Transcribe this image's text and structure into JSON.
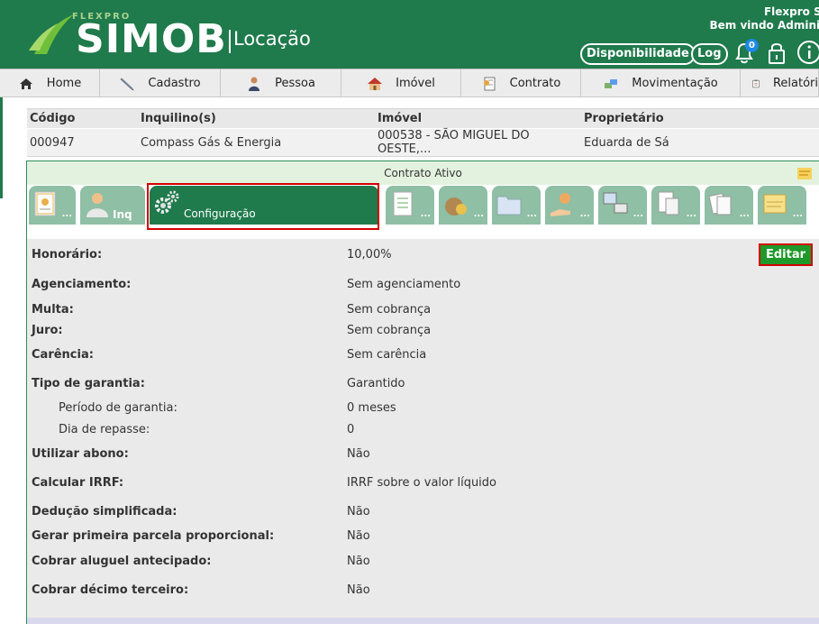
{
  "header": {
    "brand_flexpro": "FLEXPRO",
    "brand_simob": "SIMOB",
    "brand_module": "Locação",
    "company": "Flexpro Sis",
    "welcome": "Bem vindo Administ",
    "availability_label": "Disponibilidade",
    "log_label": "Log",
    "notification_count": "0"
  },
  "nav": {
    "items": [
      {
        "label": "Home",
        "icon": "home-icon"
      },
      {
        "label": "Cadastro",
        "icon": "pen-icon"
      },
      {
        "label": "Pessoa",
        "icon": "person-icon"
      },
      {
        "label": "Imóvel",
        "icon": "house-icon"
      },
      {
        "label": "Contrato",
        "icon": "contract-icon"
      },
      {
        "label": "Movimentação",
        "icon": "transfer-icon"
      },
      {
        "label": "Relatóri",
        "icon": "report-icon"
      }
    ]
  },
  "summary": {
    "headers": [
      "Código",
      "Inquilino(s)",
      "Imóvel",
      "Proprietário"
    ],
    "row": [
      "000947",
      "Compass Gás & Energia",
      "000538 - SÃO MIGUEL DO OESTE,...",
      "Eduarda de Sá"
    ]
  },
  "panel": {
    "title": "Contrato Ativo",
    "tabs": [
      {
        "label": "...",
        "icon": "certificate-icon"
      },
      {
        "label": "Inq",
        "icon": "tenant-icon"
      },
      {
        "label": "Configuração",
        "icon": "gears-icon"
      },
      {
        "label": "...",
        "icon": "checklist-icon"
      },
      {
        "label": "...",
        "icon": "money-bag-icon"
      },
      {
        "label": "...",
        "icon": "folder-icon"
      },
      {
        "label": "...",
        "icon": "coins-hand-icon"
      },
      {
        "label": "...",
        "icon": "transfer-computer-icon"
      },
      {
        "label": "...",
        "icon": "invoice-icon"
      },
      {
        "label": "...",
        "icon": "documents-icon"
      },
      {
        "label": "...",
        "icon": "note-icon"
      }
    ],
    "edit_label": "Editar"
  },
  "config": {
    "honorario": {
      "label": "Honorário:",
      "value": "10,00%"
    },
    "agenciamento": {
      "label": "Agenciamento:",
      "value": "Sem agenciamento"
    },
    "multa": {
      "label": "Multa:",
      "value": "Sem cobrança"
    },
    "juro": {
      "label": "Juro:",
      "value": "Sem cobrança"
    },
    "carencia": {
      "label": "Carência:",
      "value": "Sem carência"
    },
    "tipo_garantia": {
      "label": "Tipo de garantia:",
      "value": "Garantido"
    },
    "periodo_garantia": {
      "label": "Período de garantia:",
      "value": "0 meses"
    },
    "dia_repasse": {
      "label": "Dia de repasse:",
      "value": "0"
    },
    "utilizar_abono": {
      "label": "Utilizar abono:",
      "value": "Não"
    },
    "calcular_irrf": {
      "label": "Calcular IRRF:",
      "value": "IRRF sobre o valor líquido"
    },
    "deducao_simplificada": {
      "label": "Dedução simplificada:",
      "value": "Não"
    },
    "primeira_parcela": {
      "label": "Gerar primeira parcela proporcional:",
      "value": "Não"
    },
    "aluguel_antecipado": {
      "label": "Cobrar aluguel antecipado:",
      "value": "Não"
    },
    "decimo_terceiro": {
      "label": "Cobrar décimo terceiro:",
      "value": "Não"
    }
  }
}
